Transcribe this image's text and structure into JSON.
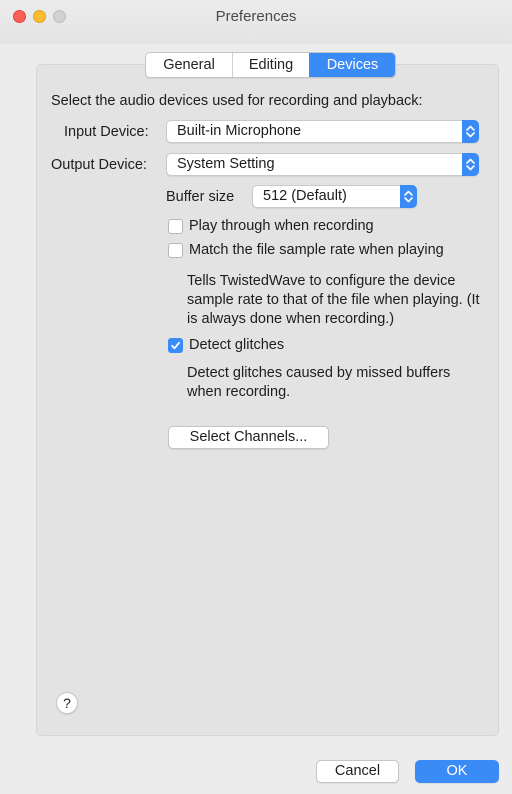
{
  "window": {
    "title": "Preferences"
  },
  "tabs": [
    {
      "label": "General",
      "active": false
    },
    {
      "label": "Editing",
      "active": false
    },
    {
      "label": "Devices",
      "active": true
    }
  ],
  "devices": {
    "intro": "Select the audio devices used for recording and playback:",
    "input_label": "Input Device:",
    "input_value": "Built-in Microphone",
    "output_label": "Output Device:",
    "output_value": "System Setting",
    "buffer_label": "Buffer size",
    "buffer_value": "512 (Default)",
    "play_through": {
      "label": "Play through when recording",
      "checked": false
    },
    "match_rate": {
      "label": "Match the file sample rate when playing",
      "checked": false
    },
    "match_desc": "Tells TwistedWave to configure the device sample rate to that of the file when playing. (It is always done when recording.)",
    "detect_glitches": {
      "label": "Detect glitches",
      "checked": true
    },
    "glitches_desc": "Detect glitches caused by missed buffers when recording.",
    "select_channels": "Select Channels..."
  },
  "footer": {
    "help": "?",
    "cancel": "Cancel",
    "ok": "OK"
  },
  "colors": {
    "accent": "#3b8bf6",
    "window_bg": "#ececec",
    "panel_bg": "#e3e3e3"
  },
  "icons": [
    "close-icon",
    "minimize-icon",
    "zoom-icon",
    "updown-chevron-icon",
    "checkmark-icon"
  ]
}
